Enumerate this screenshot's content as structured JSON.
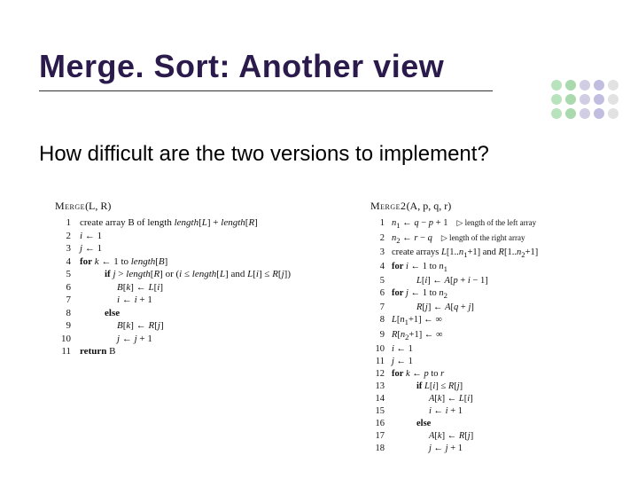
{
  "title": "Merge. Sort: Another view",
  "subtitle": "How difficult are the two versions to implement?",
  "algo_left": {
    "head_name": "Merge",
    "head_args": "(L, R)",
    "lines": [
      {
        "n": "1",
        "indent": 0,
        "html": "create array B of length <span class='it'>length</span>[<span class='it'>L</span>] + <span class='it'>length</span>[<span class='it'>R</span>]"
      },
      {
        "n": "2",
        "indent": 0,
        "html": "<span class='it'>i</span> ← 1"
      },
      {
        "n": "3",
        "indent": 0,
        "html": "<span class='it'>j</span> ← 1"
      },
      {
        "n": "4",
        "indent": 0,
        "html": "<span class='kw'>for</span> <span class='it'>k</span> ← 1 to <span class='it'>length</span>[<span class='it'>B</span>]"
      },
      {
        "n": "5",
        "indent": 2,
        "html": "<span class='kw'>if</span> <span class='it'>j</span> &gt; <span class='it'>length</span>[<span class='it'>R</span>] or (<span class='it'>i</span> ≤ <span class='it'>length</span>[<span class='it'>L</span>] and <span class='it'>L</span>[<span class='it'>i</span>] ≤ <span class='it'>R</span>[<span class='it'>j</span>])"
      },
      {
        "n": "6",
        "indent": 3,
        "html": "<span class='it'>B</span>[<span class='it'>k</span>] ← <span class='it'>L</span>[<span class='it'>i</span>]"
      },
      {
        "n": "7",
        "indent": 3,
        "html": "<span class='it'>i</span> ← <span class='it'>i</span> + 1"
      },
      {
        "n": "8",
        "indent": 2,
        "html": "<span class='kw'>else</span>"
      },
      {
        "n": "9",
        "indent": 3,
        "html": "<span class='it'>B</span>[<span class='it'>k</span>] ← <span class='it'>R</span>[<span class='it'>j</span>]"
      },
      {
        "n": "10",
        "indent": 3,
        "html": "<span class='it'>j</span> ← <span class='it'>j</span> + 1"
      },
      {
        "n": "11",
        "indent": 0,
        "html": "<span class='kw'>return</span> B"
      }
    ]
  },
  "algo_right": {
    "head_name": "Merge2",
    "head_args": "(A, p, q, r)",
    "lines": [
      {
        "n": "1",
        "indent": 0,
        "html": "<span class='it'>n</span><sub>1</sub> ← <span class='it'>q</span> − <span class='it'>p</span> + 1",
        "cmt": "▷ length of the left array"
      },
      {
        "n": "2",
        "indent": 0,
        "html": "<span class='it'>n</span><sub>2</sub> ← <span class='it'>r</span> − <span class='it'>q</span>",
        "cmt": "▷ length of the right array"
      },
      {
        "n": "3",
        "indent": 0,
        "html": "create arrays <span class='it'>L</span>[1..<span class='it'>n</span><sub>1</sub>+1] and <span class='it'>R</span>[1..<span class='it'>n</span><sub>2</sub>+1]"
      },
      {
        "n": "4",
        "indent": 0,
        "html": "<span class='kw'>for</span> <span class='it'>i</span> ← 1 to <span class='it'>n</span><sub>1</sub>"
      },
      {
        "n": "5",
        "indent": 2,
        "html": "<span class='it'>L</span>[<span class='it'>i</span>] ← <span class='it'>A</span>[<span class='it'>p</span> + <span class='it'>i</span> − 1]"
      },
      {
        "n": "6",
        "indent": 0,
        "html": "<span class='kw'>for</span> <span class='it'>j</span> ← 1 to <span class='it'>n</span><sub>2</sub>"
      },
      {
        "n": "7",
        "indent": 2,
        "html": "<span class='it'>R</span>[<span class='it'>j</span>] ← <span class='it'>A</span>[<span class='it'>q</span> + <span class='it'>j</span>]"
      },
      {
        "n": "8",
        "indent": 0,
        "html": "<span class='it'>L</span>[<span class='it'>n</span><sub>1</sub>+1] ← ∞"
      },
      {
        "n": "9",
        "indent": 0,
        "html": "<span class='it'>R</span>[<span class='it'>n</span><sub>2</sub>+1] ← ∞"
      },
      {
        "n": "10",
        "indent": 0,
        "html": "<span class='it'>i</span> ← 1"
      },
      {
        "n": "11",
        "indent": 0,
        "html": "<span class='it'>j</span> ← 1"
      },
      {
        "n": "12",
        "indent": 0,
        "html": "<span class='kw'>for</span> <span class='it'>k</span> ← <span class='it'>p</span> to <span class='it'>r</span>"
      },
      {
        "n": "13",
        "indent": 2,
        "html": "<span class='kw'>if</span> <span class='it'>L</span>[<span class='it'>i</span>] ≤ <span class='it'>R</span>[<span class='it'>j</span>]"
      },
      {
        "n": "14",
        "indent": 3,
        "html": "<span class='it'>A</span>[<span class='it'>k</span>] ← <span class='it'>L</span>[<span class='it'>i</span>]"
      },
      {
        "n": "15",
        "indent": 3,
        "html": "<span class='it'>i</span> ← <span class='it'>i</span> + 1"
      },
      {
        "n": "16",
        "indent": 2,
        "html": "<span class='kw'>else</span>"
      },
      {
        "n": "17",
        "indent": 3,
        "html": "<span class='it'>A</span>[<span class='it'>k</span>] ← <span class='it'>R</span>[<span class='it'>j</span>]"
      },
      {
        "n": "18",
        "indent": 3,
        "html": "<span class='it'>j</span> ← <span class='it'>j</span> + 1"
      }
    ]
  }
}
